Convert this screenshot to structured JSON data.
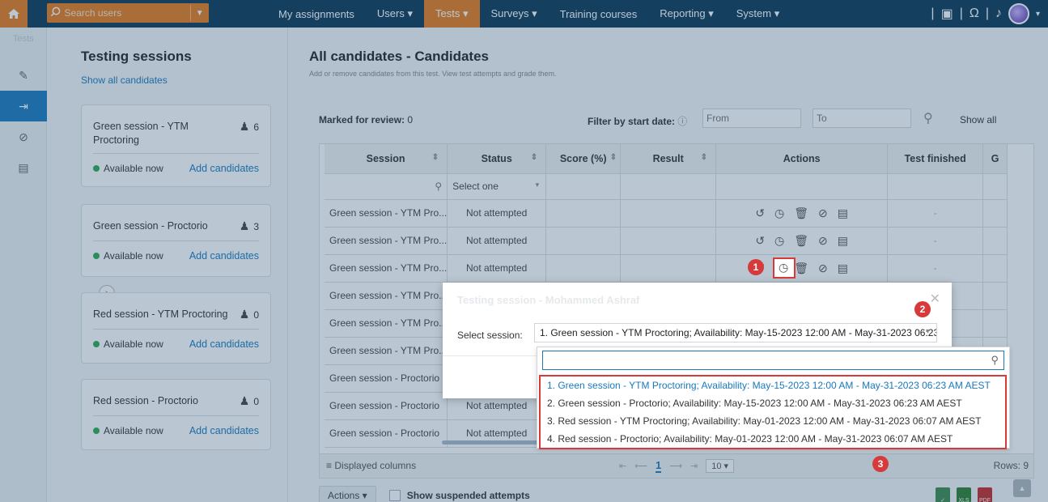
{
  "topnav": {
    "search_placeholder": "Search users",
    "items": [
      {
        "label": "My assignments"
      },
      {
        "label": "Users ▾"
      },
      {
        "label": "Tests ▾"
      },
      {
        "label": "Surveys ▾"
      },
      {
        "label": "Training courses"
      },
      {
        "label": "Reporting ▾"
      },
      {
        "label": "System ▾"
      }
    ],
    "active_index": 2
  },
  "minibar": {
    "label": "Tests"
  },
  "sessions_panel": {
    "title": "Testing sessions",
    "show_all": "Show all candidates",
    "cards": [
      {
        "title": "Green session - YTM Proctoring",
        "count": "6",
        "availability": "Available now",
        "add": "Add candidates"
      },
      {
        "title": "Green session - Proctorio",
        "count": "3",
        "availability": "Available now",
        "add": "Add candidates"
      },
      {
        "title": "Red session - YTM Proctoring",
        "count": "0",
        "availability": "Available now",
        "add": "Add candidates"
      },
      {
        "title": "Red session - Proctorio",
        "count": "0",
        "availability": "Available now",
        "add": "Add candidates"
      }
    ]
  },
  "main": {
    "title": "All candidates - Candidates",
    "subtitle": "Add or remove candidates from this test. View test attempts and grade them.",
    "marked_label": "Marked for review:",
    "marked_value": "0",
    "filter_label": "Filter by start date:",
    "from_placeholder": "From",
    "to_placeholder": "To",
    "show_all": "Show all"
  },
  "grid": {
    "columns": [
      "Session",
      "Status",
      "Score (%)",
      "Result",
      "Actions",
      "Test finished",
      "G"
    ],
    "status_filter": "Select one",
    "rows": [
      {
        "session": "Green session - YTM Pro...",
        "status": "Not attempted",
        "finished": "-"
      },
      {
        "session": "Green session - YTM Pro...",
        "status": "Not attempted",
        "finished": "-"
      },
      {
        "session": "Green session - YTM Pro...",
        "status": "Not attempted",
        "finished": "-"
      },
      {
        "session": "Green session - YTM Pro...",
        "status": "",
        "finished": ""
      },
      {
        "session": "Green session - YTM Pro...",
        "status": "",
        "finished": ""
      },
      {
        "session": "Green session - YTM Pro...",
        "status": "",
        "finished": ""
      },
      {
        "session": "Green session - Proctorio",
        "status": "",
        "finished": ""
      },
      {
        "session": "Green session - Proctorio",
        "status": "Not attempted",
        "finished": ""
      },
      {
        "session": "Green session - Proctorio",
        "status": "Not attempted",
        "finished": ""
      }
    ],
    "footer": {
      "displayed_columns": "Displayed columns",
      "page": "1",
      "page_size": "10 ▾",
      "rows": "Rows: 9"
    }
  },
  "bottom": {
    "actions": "Actions ▾",
    "show_suspended": "Show suspended attempts"
  },
  "modal": {
    "title": "Testing session - Mohammed Ashraf",
    "select_label": "Select session:",
    "selected": "1. Green session - YTM Proctoring; Availability: May-15-2023 12:00 AM - May-31-2023 06:23 AM AEST",
    "options": [
      "1. Green session - YTM Proctoring; Availability: May-15-2023 12:00 AM - May-31-2023 06:23 AM AEST",
      "2. Green session - Proctorio; Availability: May-15-2023 12:00 AM - May-31-2023 06:23 AM AEST",
      "3. Red session - YTM Proctoring; Availability: May-01-2023 12:00 AM - May-31-2023 06:07 AM AEST",
      "4. Red session - Proctorio; Availability: May-01-2023 12:00 AM - May-31-2023 06:07 AM AEST"
    ]
  },
  "callouts": [
    "1",
    "2",
    "3"
  ],
  "colors": {
    "nav": "#0d3756",
    "accent": "#e97b1b",
    "link": "#1a78bd",
    "callout": "#d63a3a"
  }
}
